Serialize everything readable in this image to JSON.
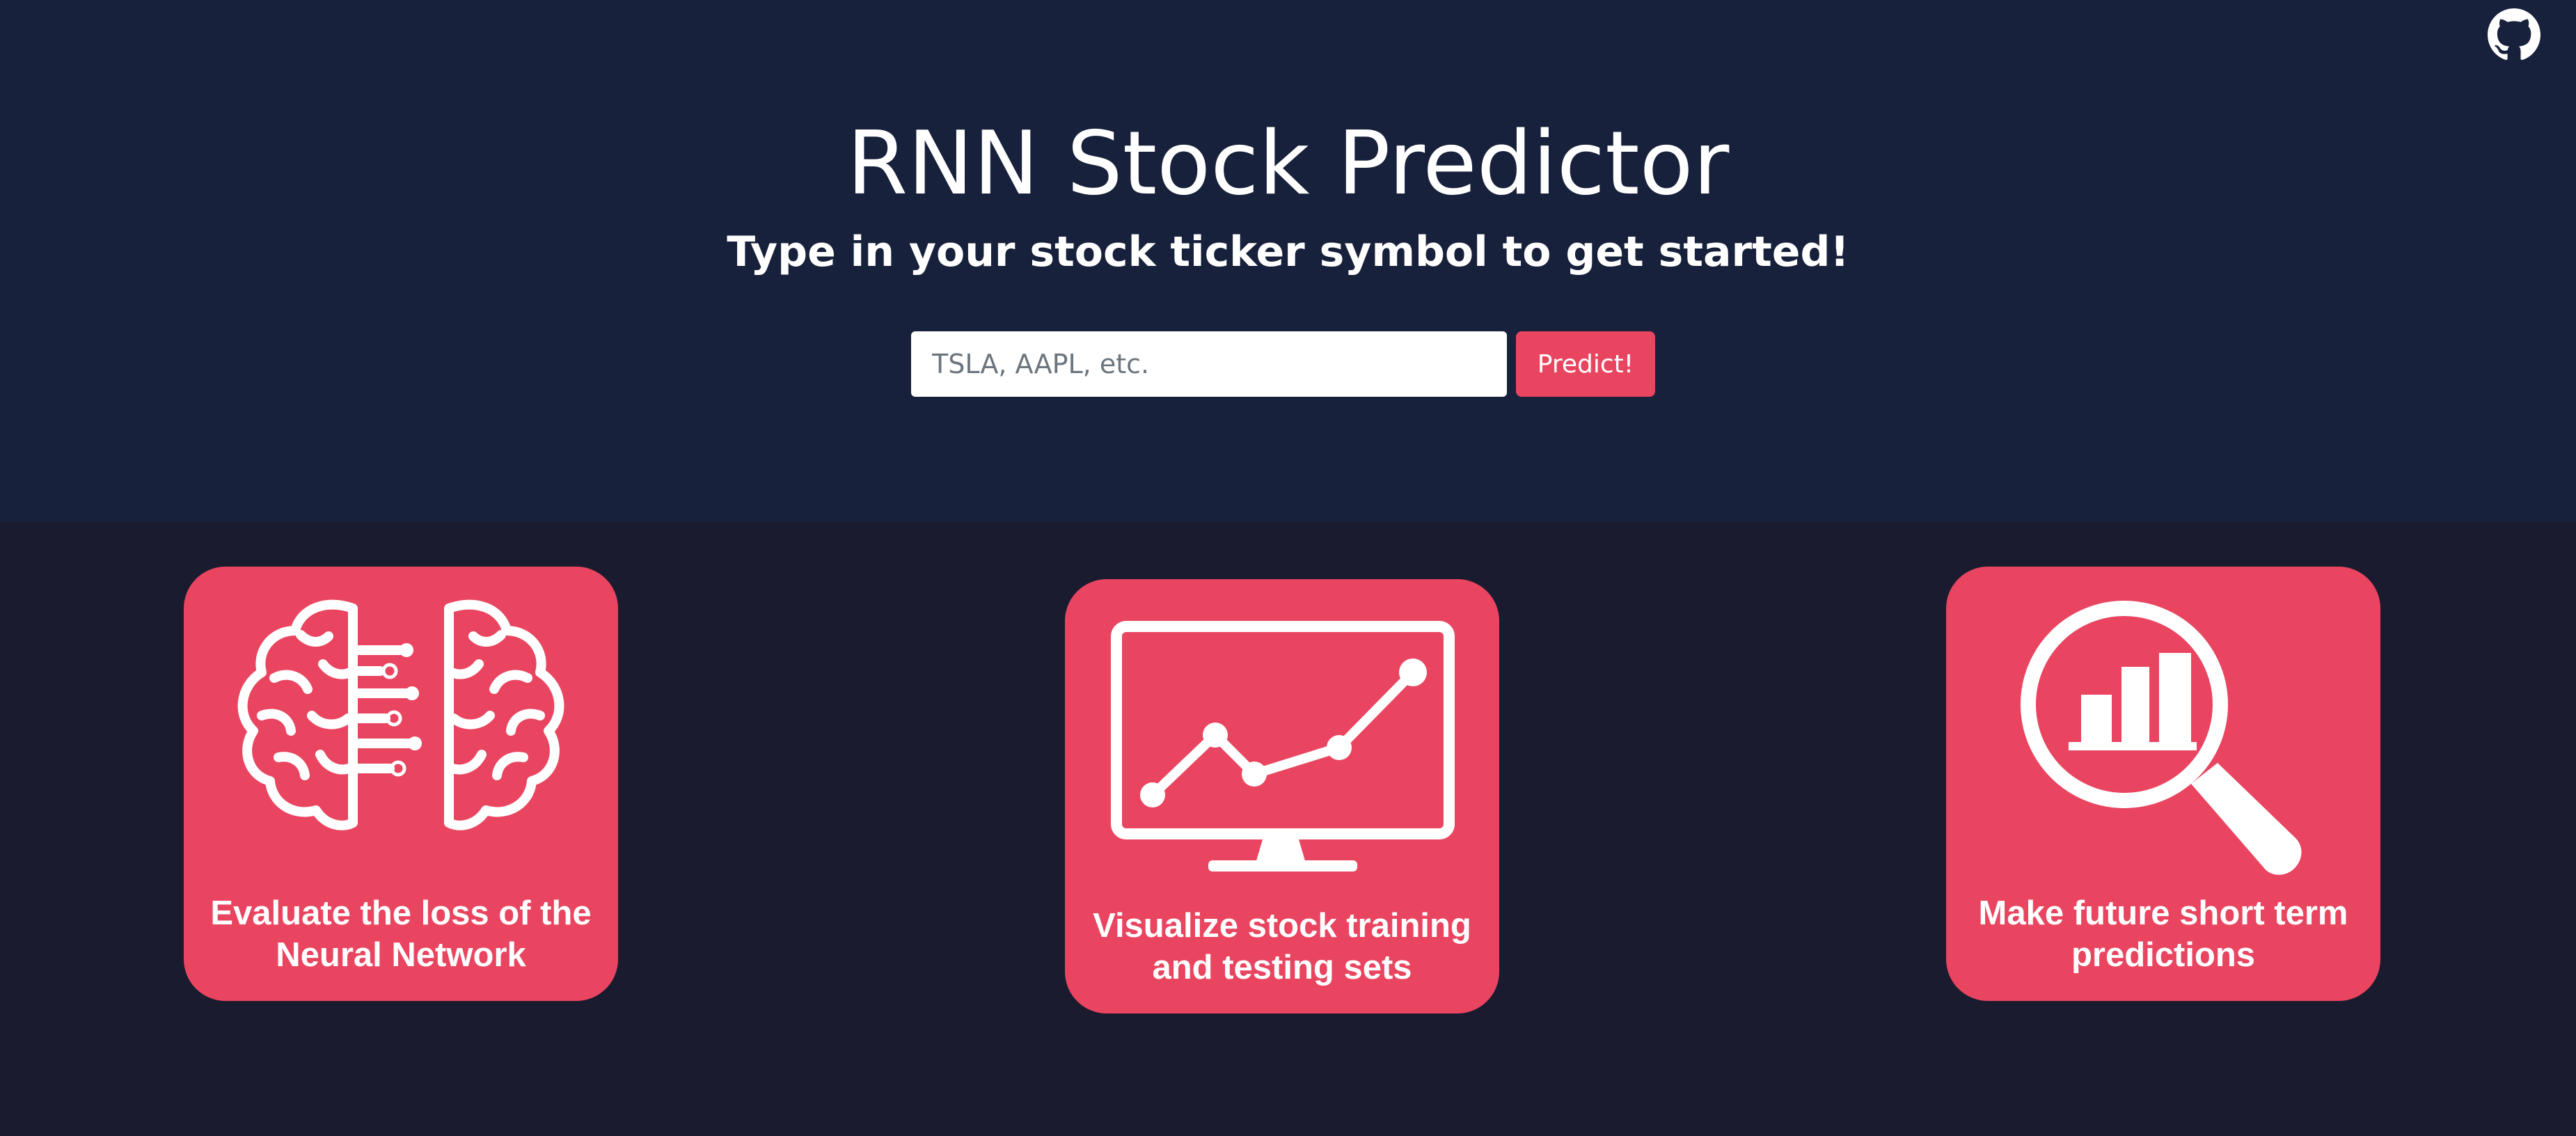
{
  "header": {
    "title": "RNN Stock Predictor",
    "subtitle": "Type in your stock ticker symbol to get started!",
    "github_icon": "github-icon"
  },
  "search": {
    "placeholder": "TSLA, AAPL, etc.",
    "value": "",
    "button_label": "Predict!"
  },
  "features": [
    {
      "icon": "brain-circuit-icon",
      "caption": "Evaluate the loss of the Neural Network"
    },
    {
      "icon": "monitor-line-chart-icon",
      "caption": "Visualize stock training and testing sets"
    },
    {
      "icon": "magnifier-bar-chart-icon",
      "caption": "Make future short term predictions"
    }
  ],
  "colors": {
    "hero_background": "#18213b",
    "page_background": "#1b1b2f",
    "accent": "#e94560",
    "text": "#ffffff"
  }
}
